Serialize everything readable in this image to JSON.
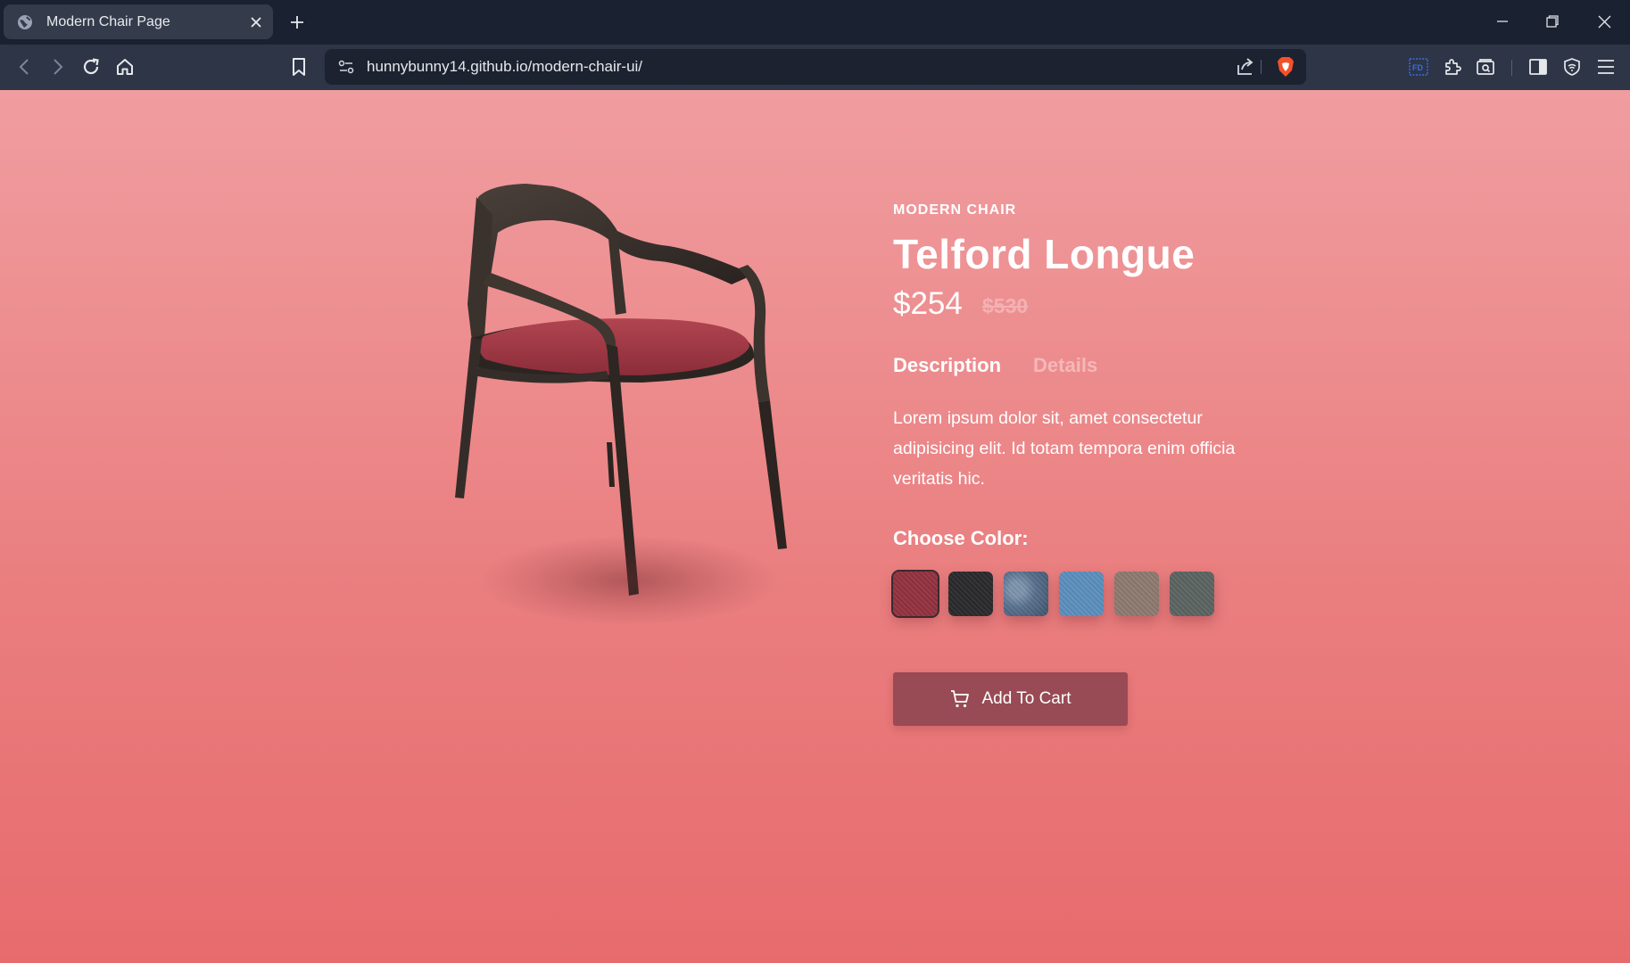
{
  "browser": {
    "tab": {
      "title": "Modern Chair Page"
    },
    "address_bar": {
      "url": "hunnybunny14.github.io/modern-chair-ui/"
    }
  },
  "product": {
    "eyebrow": "MODERN CHAIR",
    "name": "Telford Longue",
    "price": "$254",
    "old_price": "$530",
    "tabs": [
      {
        "label": "Description",
        "active": true
      },
      {
        "label": "Details",
        "active": false
      }
    ],
    "description": "Lorem ipsum dolor sit, amet consectetur adipisicing elit. Id totam tempora enim officia veritatis hic.",
    "color_label": "Choose Color:",
    "swatches": [
      {
        "name": "red-fabric",
        "color": "#93323f",
        "selected": true
      },
      {
        "name": "black-fabric",
        "color": "#2a2a2d",
        "selected": false
      },
      {
        "name": "denim-fabric",
        "color": "#58708e",
        "selected": false
      },
      {
        "name": "light-blue-fabric",
        "color": "#5b8fbd",
        "selected": false
      },
      {
        "name": "taupe-fabric",
        "color": "#8d7a70",
        "selected": false
      },
      {
        "name": "gray-fabric",
        "color": "#5c6462",
        "selected": false
      }
    ],
    "cart_button": {
      "label": "Add To Cart",
      "icon": "cart-icon"
    }
  },
  "colors": {
    "accent": "#984a55",
    "background_top": "#f09da0",
    "background_bottom": "#e76b6d"
  }
}
